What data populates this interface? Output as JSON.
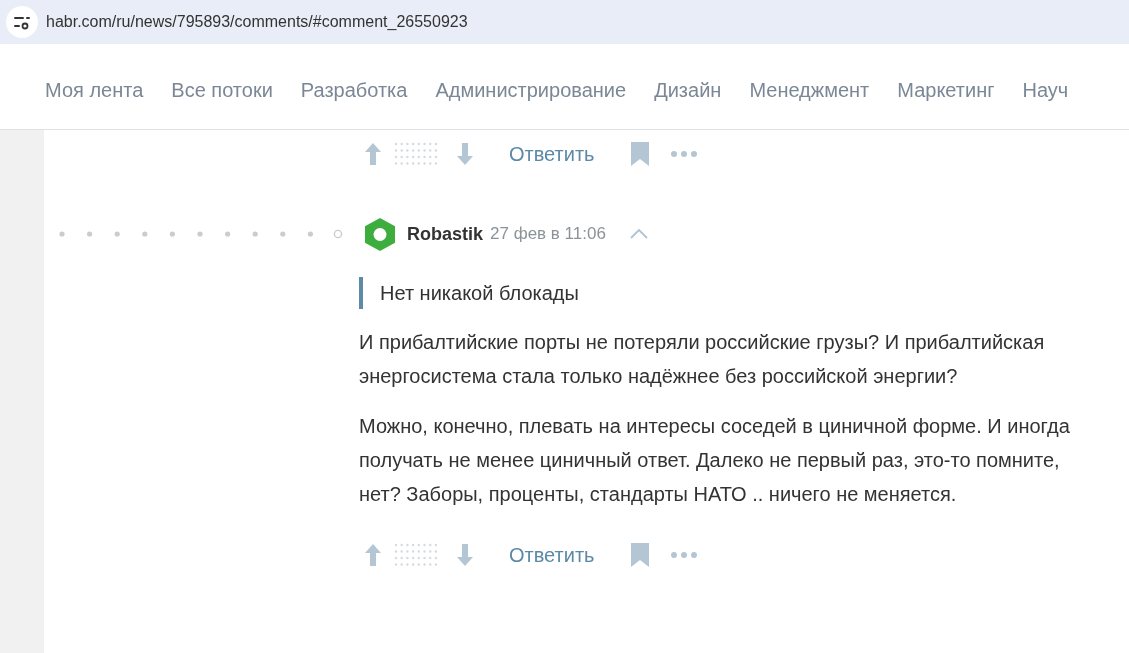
{
  "address_bar": {
    "url": "habr.com/ru/news/795893/comments/#comment_26550923"
  },
  "nav": {
    "items": [
      {
        "label": "Моя лента"
      },
      {
        "label": "Все потоки"
      },
      {
        "label": "Разработка"
      },
      {
        "label": "Администрирование"
      },
      {
        "label": "Дизайн"
      },
      {
        "label": "Менеджмент"
      },
      {
        "label": "Маркетинг"
      },
      {
        "label": "Науч"
      }
    ]
  },
  "previous_comment_actions": {
    "reply": "Ответить"
  },
  "comment": {
    "author": "Robastik",
    "time": "27 фев в 11:06",
    "quote": "Нет никакой блокады",
    "paragraphs": [
      "И прибалтийские порты не потеряли российские грузы? И прибалтийская энергосистема стала только надёжнее без российской энергии?",
      "Можно, конечно, плевать на интересы соседей в циничной форме. И иногда получать не менее циничный ответ. Далеко не первый раз, это-то помните, нет? Заборы, проценты, стандарты НАТО .. ничего не меняется."
    ],
    "actions": {
      "reply": "Ответить"
    }
  }
}
